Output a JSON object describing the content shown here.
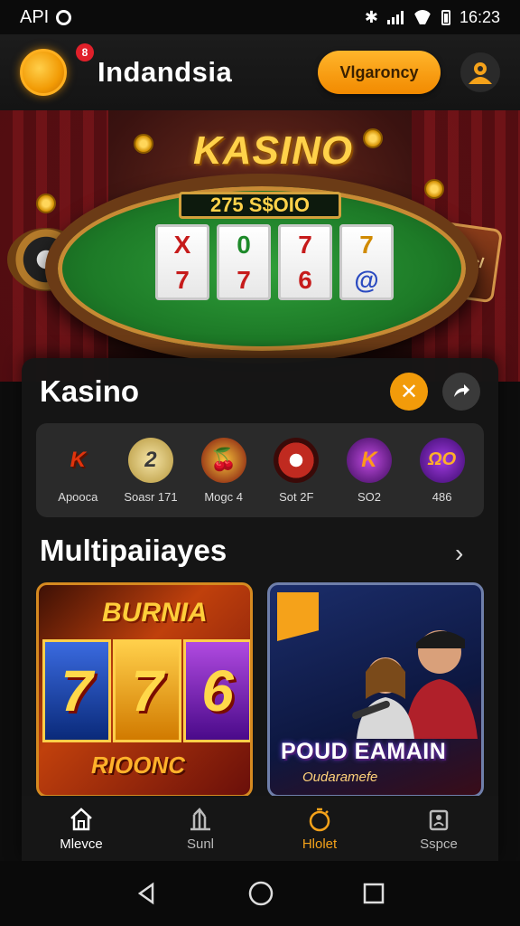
{
  "status_bar": {
    "carrier": "API",
    "time": "16:23"
  },
  "header": {
    "brand": "Indandsia",
    "cta_label": "Vlgaroncy",
    "notification_badge": "8"
  },
  "hero": {
    "title": "KASINO",
    "ticker": "275 S$OIO",
    "reels": [
      [
        "X",
        "7"
      ],
      [
        "0",
        "7"
      ],
      [
        "7",
        "6"
      ],
      [
        "7",
        "@"
      ]
    ],
    "sign_text": "Sqandwicl"
  },
  "kasino_section": {
    "title": "Kasino",
    "close_symbol": "✕",
    "games": [
      {
        "label": "Apooca",
        "glyph": "K",
        "color": "#e0330c"
      },
      {
        "label": "Soasr 171",
        "glyph": "2",
        "color": "#d9c37a"
      },
      {
        "label": "Mogc 4",
        "glyph": "🍒",
        "color": "#f29b0a"
      },
      {
        "label": "Sot 2F",
        "glyph": "◎",
        "color": "#c02a20"
      },
      {
        "label": "SO2",
        "glyph": "K",
        "color": "#7a22c8"
      },
      {
        "label": "486",
        "glyph": "ΩO",
        "color": "#8a2ad0"
      }
    ]
  },
  "multiplayer_section": {
    "title": "Multipaiiayes",
    "cards": [
      {
        "title": "BURNIA",
        "reels": [
          "7",
          "7",
          "6"
        ],
        "subtitle": "RIOONC"
      },
      {
        "title": "POUD EAMAIN",
        "subtitle": "Oudaramefe"
      }
    ]
  },
  "bottom_tabs": [
    {
      "label": "Mlevce",
      "icon": "home-icon"
    },
    {
      "label": "Sunl",
      "icon": "chart-icon"
    },
    {
      "label": "Hlolet",
      "icon": "timer-icon"
    },
    {
      "label": "Sspce",
      "icon": "profile-icon"
    }
  ],
  "colors": {
    "accent": "#f29b0a",
    "panel": "#161616",
    "table_green": "#1d7a27"
  }
}
